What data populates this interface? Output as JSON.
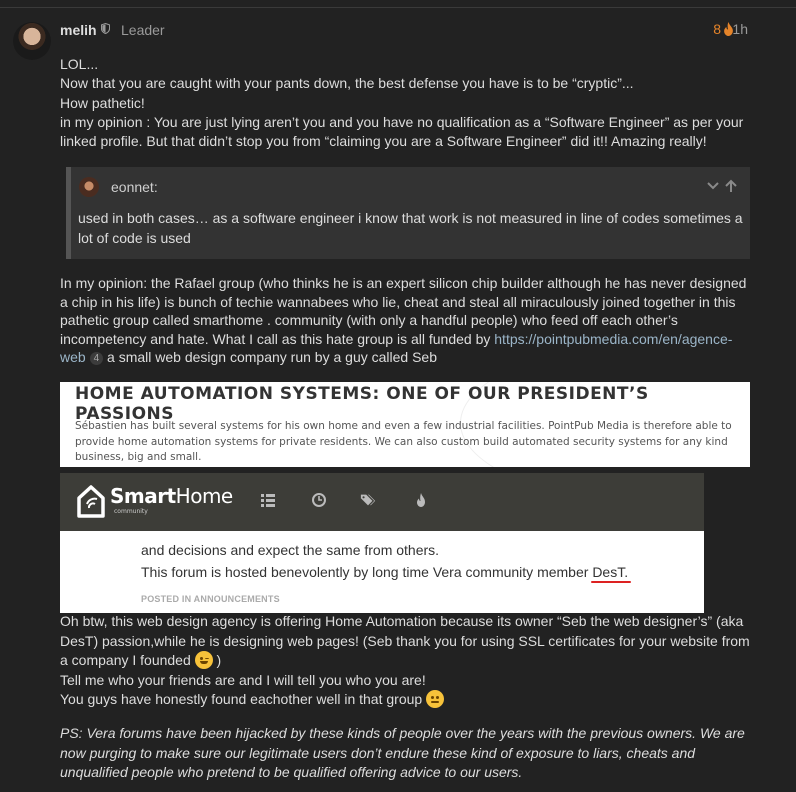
{
  "post": {
    "username": "melih",
    "user_title": "Leader",
    "like_count": "8",
    "age": "1h",
    "intro_lines": [
      "LOL...",
      "Now that you are caught with your pants down, the best defense you have is to be “cryptic”...",
      "How pathetic!",
      "in my opinion : You are just lying aren’t you and you have no qualification as a “Software Engineer” as per your linked profile. But that didn’t stop you from “claiming you are a Software Engineer” did it!! Amazing really!"
    ],
    "quote": {
      "username": "eonnet:",
      "text": "used in both cases… as a software engineer i know that work is not measured in line of codes sometimes a lot of code is used"
    },
    "paragraph_main": "In my opinion: the Rafael group (who thinks he is an expert silicon chip builder although he has never designed a chip in his life) is bunch of techie wannabees who lie, cheat and steal all miraculously joined together in this pathetic group called smarthome . community (with only a handful people) who feed off each other’s incompetency and hate. What I call as this hate group is all funded by",
    "link_text": "https://pointpubmedia.com/en/agence-web",
    "link_count": "4",
    "paragraph_tail": "a small web design company run by a guy called Seb",
    "image1": {
      "title": "HOME AUTOMATION SYSTEMS: ONE OF OUR PRESIDENT’S PASSIONS",
      "text": "Sébastien has built several systems for his own home and even a few industrial facilities. PointPub Media is therefore able to provide home automation systems for private residents. We can also custom build automated security systems for any kind business, big and small."
    },
    "image2": {
      "logo_bold": "Smart",
      "logo_rest": "Home",
      "logo_sub": "community",
      "line1": "and decisions and expect the same from others.",
      "line2_prefix": "This forum is hosted benevolently by long time Vera community member ",
      "line2_name": "DesT.",
      "posted_in": "POSTED IN ANNOUNCEMENTS"
    },
    "outro": {
      "p1_before_emoji": "Oh btw, this web design agency is offering Home Automation because its owner “Seb the web designer’s” (aka DesT) passion,while he is designing web pages! (Seb thank you for using SSL certificates for your website from a company I founded",
      "p1_after_emoji": ")",
      "p2": "Tell me who your friends are and I will tell you who you are!",
      "p3": "You guys have honestly found eachother well in that group"
    },
    "ps": "PS: Vera forums have been hijacked by these kinds of people over the years with the previous owners. We are now purging to make sure our legitimate users don’t endure these kind of exposure to liars, cheats and unqualified people who pretend to be qualified offering advice to our users."
  },
  "colors": {
    "background": "#222222",
    "text": "#dddddd",
    "muted": "#9a9a9a",
    "like_accent": "#e5842a",
    "link": "#9bb5c8",
    "quote_bg": "#333333"
  },
  "icons": [
    "shield-icon",
    "flame-icon",
    "chevron-down-icon",
    "arrow-up-icon",
    "list-icon",
    "clock-icon",
    "tags-icon",
    "flame-icon"
  ]
}
